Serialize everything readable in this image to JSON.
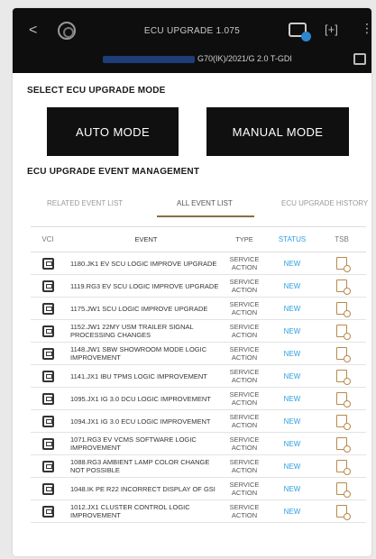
{
  "appbar": {
    "back": "<",
    "title": "ECU UPGRADE 1.075",
    "subtitle": "G70(IK)/2021/G 2.0 T-GDI",
    "expand": "[+]",
    "more": "⋮"
  },
  "mode_section": {
    "title": "SELECT ECU UPGRADE MODE",
    "auto": "AUTO MODE",
    "manual": "MANUAL MODE"
  },
  "event_section": {
    "title": "ECU UPGRADE EVENT MANAGEMENT",
    "tabs": [
      "RELATED EVENT LIST",
      "ALL EVENT LIST",
      "ECU UPGRADE HISTORY"
    ]
  },
  "table": {
    "headers": [
      "VCI",
      "EVENT",
      "TYPE",
      "STATUS",
      "TSB"
    ],
    "rows": [
      {
        "event": "1180.JK1 EV SCU LOGIC IMPROVE UPGRADE",
        "type": "SERVICE ACTION",
        "status": "NEW"
      },
      {
        "event": "1119.RG3 EV SCU LOGIC IMPROVE UPGRADE",
        "type": "SERVICE ACTION",
        "status": "NEW"
      },
      {
        "event": "1175.JW1 SCU LOGIC IMPROVE UPGRADE",
        "type": "SERVICE ACTION",
        "status": "NEW"
      },
      {
        "event": "1152.JW1 22MY USM TRAILER SIGNAL PROCESSING CHANGES",
        "type": "SERVICE ACTION",
        "status": "NEW"
      },
      {
        "event": "1148.JW1 SBW SHOWROOM MODE LOGIC IMPROVEMENT",
        "type": "SERVICE ACTION",
        "status": "NEW"
      },
      {
        "event": "1141.JX1 IBU TPMS LOGIC IMPROVEMENT",
        "type": "SERVICE ACTION",
        "status": "NEW"
      },
      {
        "event": "1095.JX1 IG 3.0 DCU LOGIC IMPROVEMENT",
        "type": "SERVICE ACTION",
        "status": "NEW"
      },
      {
        "event": "1094.JX1 IG 3.0 ECU LOGIC IMPROVEMENT",
        "type": "SERVICE ACTION",
        "status": "NEW"
      },
      {
        "event": "1071.RG3 EV VCMS SOFTWARE LOGIC IMPROVEMENT",
        "type": "SERVICE ACTION",
        "status": "NEW"
      },
      {
        "event": "1088.RG3 AMBIENT LAMP COLOR CHANGE NOT POSSIBLE",
        "type": "SERVICE ACTION",
        "status": "NEW"
      },
      {
        "event": "1048.IK PE R22 INCORRECT DISPLAY OF GSI",
        "type": "SERVICE ACTION",
        "status": "NEW"
      },
      {
        "event": "1012.JX1 CLUSTER CONTROL LOGIC IMPROVEMENT",
        "type": "SERVICE ACTION",
        "status": "NEW"
      }
    ]
  },
  "colors": {
    "status_new": "#2ca0e0",
    "tab_underline": "#8a6d4a",
    "tsb_icon": "#b8894a",
    "appbar_bg": "#0e0e0e"
  }
}
